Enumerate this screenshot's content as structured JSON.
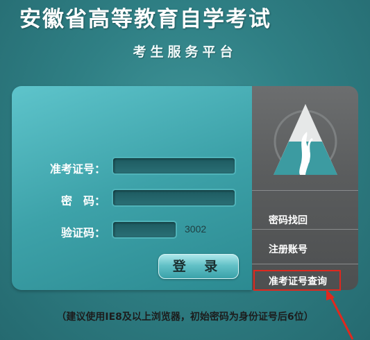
{
  "header": {
    "title": "安徽省高等教育自学考试",
    "subtitle": "考生服务平台"
  },
  "form": {
    "exam_id_label": "准考证号：",
    "password_label": "密　码：",
    "captcha_label": "验证码：",
    "exam_id_value": "",
    "password_value": "",
    "captcha_value": "",
    "captcha_code": "3002",
    "login_button": "登 录"
  },
  "side_menu": {
    "items": [
      {
        "label": "密码找回"
      },
      {
        "label": "注册账号"
      },
      {
        "label": "准考证号查询"
      }
    ]
  },
  "footer": {
    "note": "（建议使用IE8及以上浏览器，初始密码为身份证号后6位）"
  },
  "colors": {
    "background": "#2f7f84",
    "panel": "#3da2a9",
    "side_panel": "#5a5c5d",
    "highlight": "#e0281e"
  },
  "icons": [
    "mountain-logo-icon",
    "red-arrow-icon"
  ]
}
